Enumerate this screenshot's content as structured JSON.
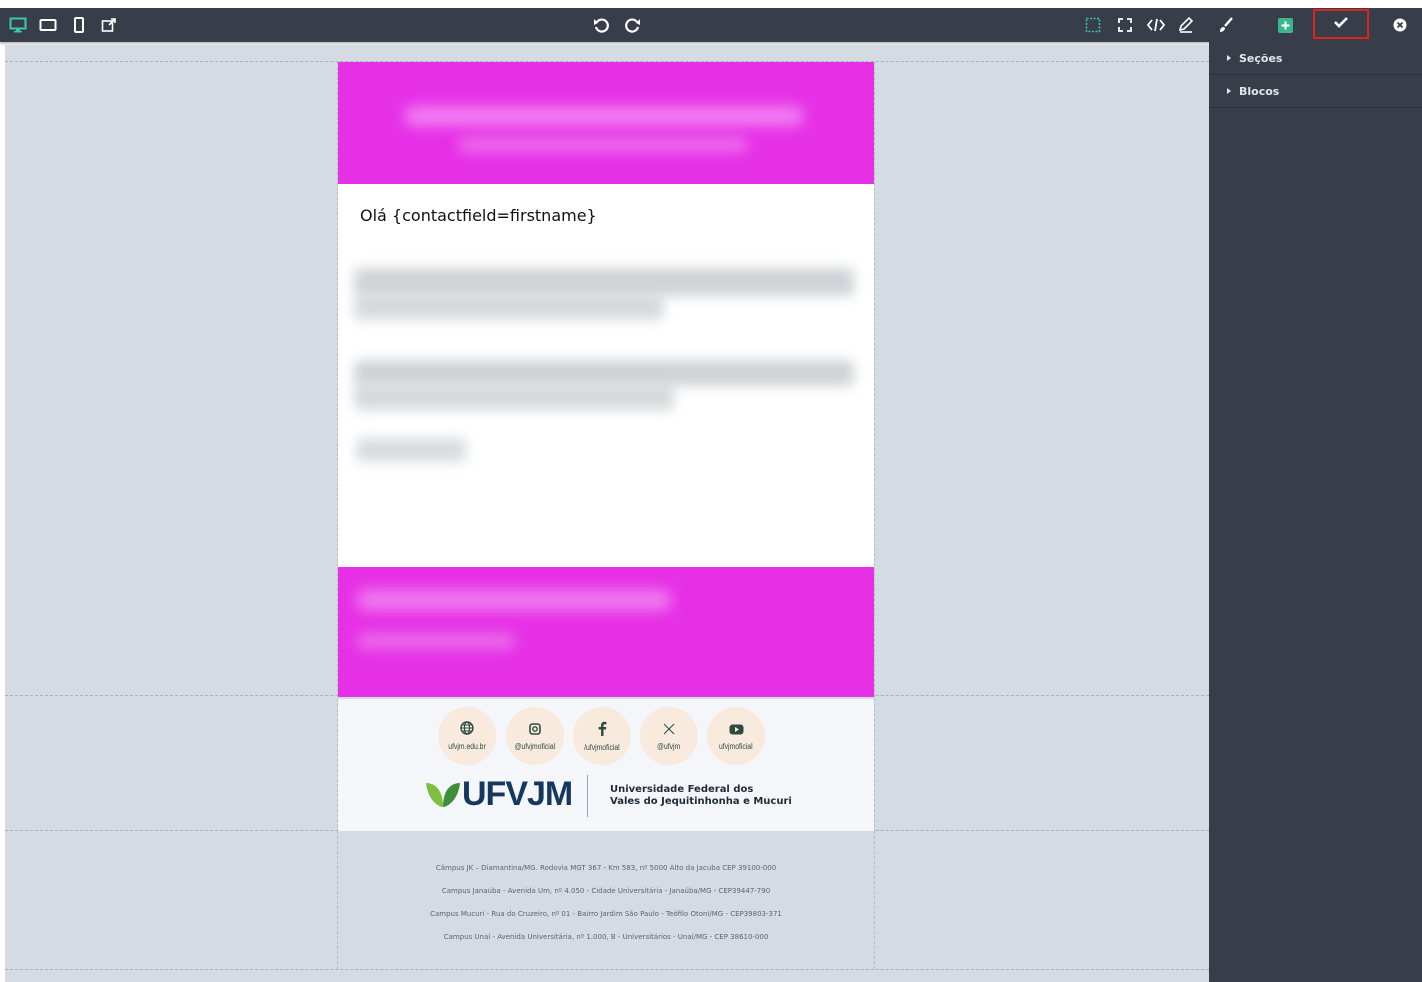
{
  "toolbar": {
    "left_icons": [
      "desktop-icon",
      "tablet-icon",
      "mobile-icon",
      "external-link-icon"
    ],
    "center_icons": [
      "undo-icon",
      "redo-icon"
    ],
    "right_icons": [
      "select-area-icon",
      "fullscreen-icon",
      "code-icon",
      "pencil-icon",
      "brush-icon",
      "add-block-icon",
      "check-icon",
      "close-icon"
    ],
    "accent_plus": "#3bb58d",
    "highlight_border": "#d9251e"
  },
  "email": {
    "hero_color": "#e630e6",
    "greeting": "Olá {contactfield=firstname}",
    "social": [
      {
        "icon": "globe-icon",
        "label": "ufvjm.edu.br"
      },
      {
        "icon": "instagram-icon",
        "label": "@ufvjmoficial"
      },
      {
        "icon": "facebook-icon",
        "label": "/ufvjmoficial"
      },
      {
        "icon": "x-icon",
        "label": "@ufvjm"
      },
      {
        "icon": "youtube-icon",
        "label": "ufvjmoficial"
      }
    ],
    "logo": {
      "text": "UFVJM",
      "caption_line1": "Universidade Federal dos",
      "caption_line2": "Vales do Jequitinhonha e Mucuri"
    },
    "addresses": [
      "Câmpus JK – Diamantina/MG. Rodovia MGT 367 - Km 583, nº 5000 Alto da Jacuba CEP 39100-000",
      "Campus Janaúba - Avenida Um, nº 4.050 - Cidade Universitária - Janaúba/MG - CEP39447-790",
      "Campus Mucuri - Rua do Cruzeiro, nº 01 - Bairro Jardim São Paulo - Teófilo Otoni/MG - CEP39803-371",
      "Campus Unaí - Avenida Universitária, nº 1.000, B - Universitários - Unaí/MG - CEP 38610-000"
    ]
  },
  "panel": {
    "items": [
      {
        "label": "Seções"
      },
      {
        "label": "Blocos"
      }
    ]
  }
}
